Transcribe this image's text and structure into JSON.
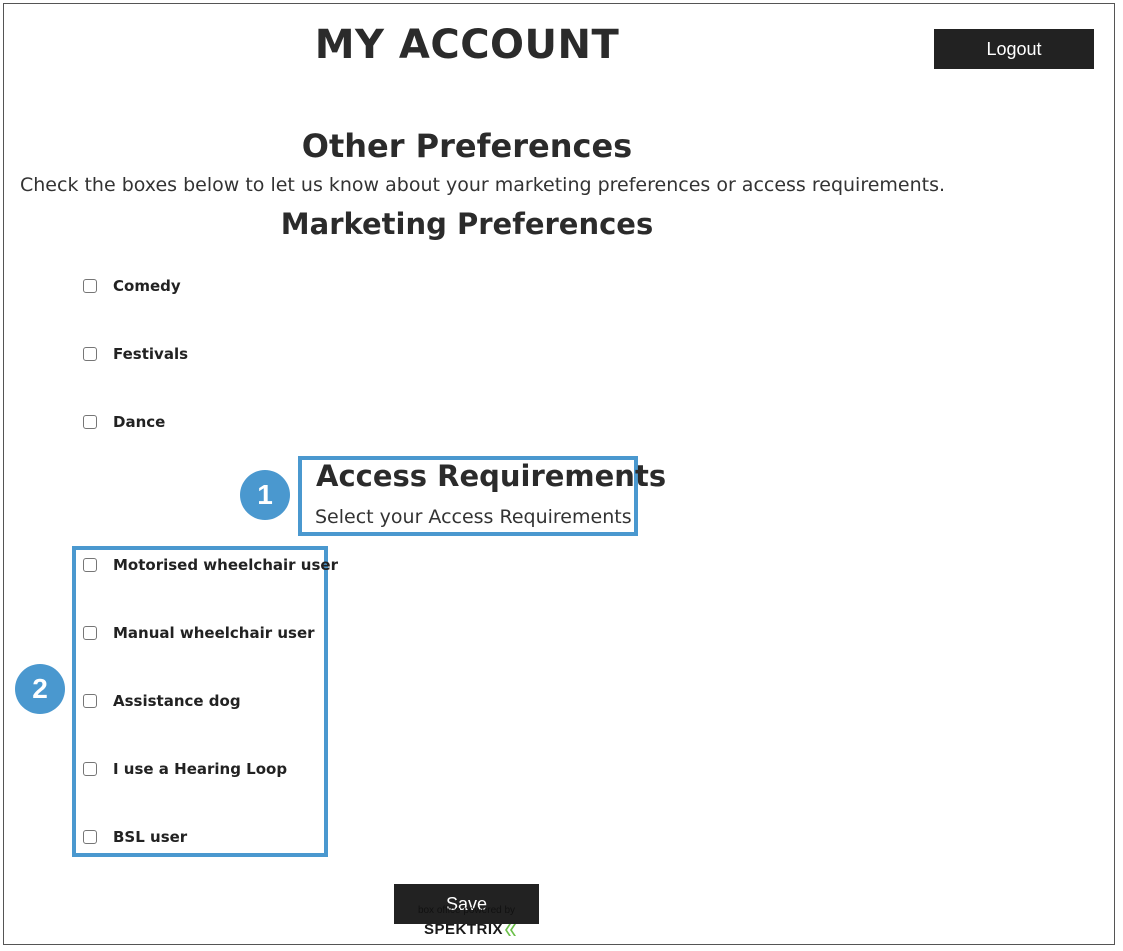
{
  "header": {
    "title": "MY ACCOUNT",
    "logout_label": "Logout"
  },
  "other_preferences": {
    "heading": "Other Preferences",
    "intro": "Check the boxes below to let us know about your marketing preferences or access requirements."
  },
  "marketing": {
    "heading": "Marketing Preferences",
    "items": [
      {
        "label": "Comedy",
        "checked": false
      },
      {
        "label": "Festivals",
        "checked": false
      },
      {
        "label": "Dance",
        "checked": false
      }
    ]
  },
  "access": {
    "heading": "Access Requirements",
    "subheading": "Select your Access Requirements",
    "items": [
      {
        "label": "Motorised wheelchair user",
        "checked": false
      },
      {
        "label": "Manual wheelchair user",
        "checked": false
      },
      {
        "label": "Assistance dog",
        "checked": false
      },
      {
        "label": "I use a Hearing Loop",
        "checked": false
      },
      {
        "label": "BSL user",
        "checked": false
      }
    ]
  },
  "callouts": {
    "one": "1",
    "two": "2",
    "color": "#4a98cf"
  },
  "footer": {
    "save_label": "Save",
    "powered_by": "box office powered by",
    "brand": "SPEKTRIX"
  }
}
